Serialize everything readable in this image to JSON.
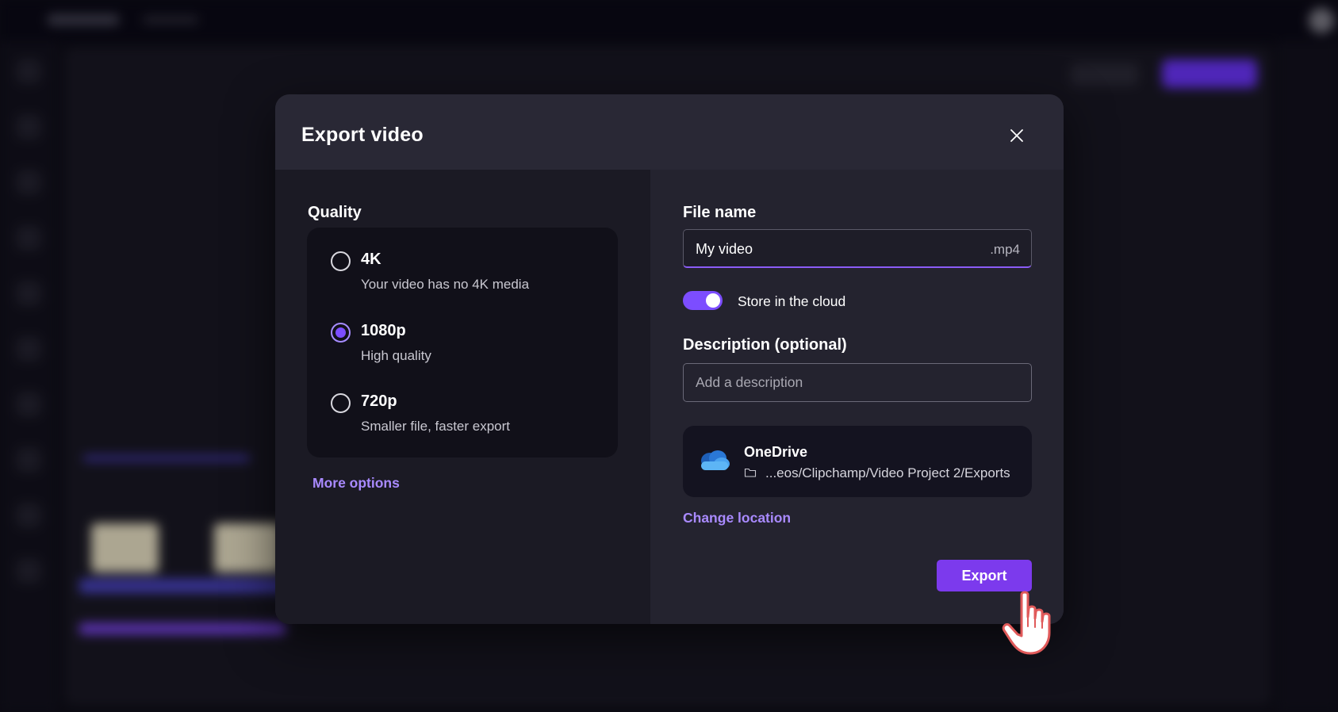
{
  "dialog": {
    "title": "Export video"
  },
  "quality": {
    "label": "Quality",
    "selected": "1080p",
    "options": [
      {
        "title": "4K",
        "subtitle": "Your video has no 4K media"
      },
      {
        "title": "1080p",
        "subtitle": "High quality"
      },
      {
        "title": "720p",
        "subtitle": "Smaller file, faster export"
      }
    ],
    "more_options": "More options"
  },
  "file": {
    "label": "File name",
    "value": "My video",
    "extension": ".mp4"
  },
  "cloud": {
    "label": "Store in the cloud",
    "enabled": true
  },
  "description": {
    "label": "Description (optional)",
    "placeholder": "Add a description",
    "value": ""
  },
  "location": {
    "service": "OneDrive",
    "path": "...eos/Clipchamp/Video Project 2/Exports",
    "change_label": "Change location"
  },
  "actions": {
    "export_label": "Export"
  },
  "colors": {
    "accent": "#7c3aed",
    "link": "#a98aff",
    "dialog_bg": "#24232f",
    "left_pane_bg": "#1b1a24"
  },
  "icons": {
    "close": "close-icon",
    "cloud": "onedrive-cloud-icon",
    "folder": "folder-icon",
    "cursor": "hand-pointer-cursor-icon"
  }
}
